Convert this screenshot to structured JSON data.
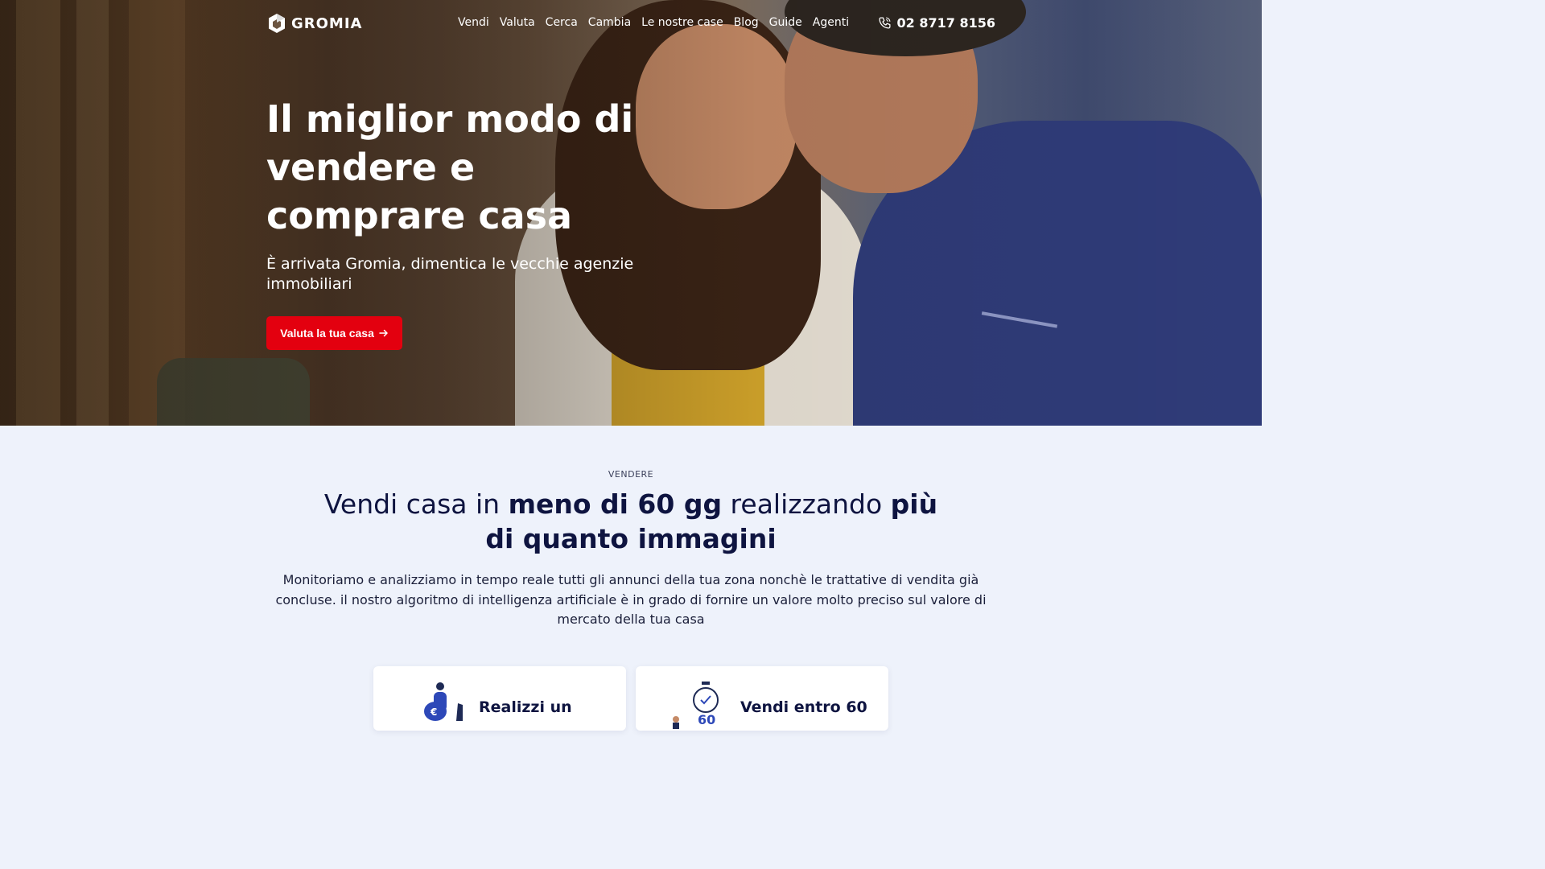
{
  "brand": {
    "name": "GROMIA",
    "logo_icon": "hexagon-logo-icon"
  },
  "nav": {
    "items": [
      "Vendi",
      "Valuta",
      "Cerca",
      "Cambia",
      "Le nostre case",
      "Blog",
      "Guide",
      "Agenti"
    ],
    "phone_icon": "phone-icon",
    "phone": "02 8717 8156"
  },
  "hero": {
    "title": "Il miglior modo di vendere e comprare casa",
    "subtitle": "È arrivata Gromia, dimentica le vecchie agenzie immobiliari",
    "cta_label": "Valuta la tua casa",
    "cta_icon": "arrow-right-icon"
  },
  "section": {
    "kicker": "VENDERE",
    "headline_parts": [
      "Vendi casa in ",
      "meno di 60 gg",
      " realizzando ",
      "più di quanto immagini"
    ],
    "description": "Monitoriamo e analizziamo in tempo reale tutti gli annunci della tua zona nonchè le trattative di vendita già concluse. il nostro algoritmo di intelligenza artificiale è in grado di fornire un valore molto preciso sul valore di mercato della tua casa",
    "cards": [
      {
        "title": "Realizzi un",
        "icon": "person-money-illustration"
      },
      {
        "title": "Vendi entro 60",
        "icon": "stopwatch-60-illustration",
        "badge": "60"
      }
    ]
  },
  "colors": {
    "accent": "#e3000f",
    "navy": "#0e1440",
    "section_bg": "#eef2fb",
    "illustration_blue": "#2d48b8"
  }
}
